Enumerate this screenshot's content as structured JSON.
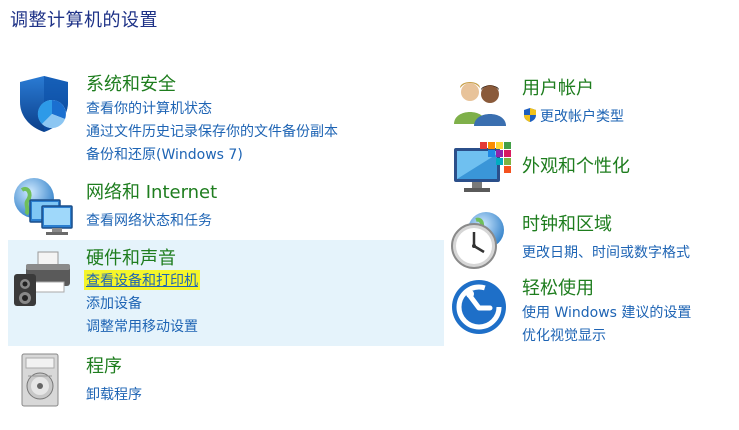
{
  "page": {
    "title": "调整计算机的设置"
  },
  "categories": {
    "system_security": {
      "title": "系统和安全",
      "icon": "security-shield-icon",
      "links": [
        "查看你的计算机状态",
        "通过文件历史记录保存你的文件备份副本",
        "备份和还原(Windows 7)"
      ]
    },
    "network": {
      "title": "网络和 Internet",
      "icon": "network-computers-icon",
      "links": [
        "查看网络状态和任务"
      ]
    },
    "hardware_sound": {
      "title": "硬件和声音",
      "icon": "printer-speaker-icon",
      "links": [
        "查看设备和打印机",
        "添加设备",
        "调整常用移动设置"
      ]
    },
    "programs": {
      "title": "程序",
      "icon": "programs-disc-icon",
      "links": [
        "卸载程序"
      ]
    },
    "user_accounts": {
      "title": "用户帐户",
      "icon": "users-icon",
      "links": [
        "更改帐户类型"
      ]
    },
    "appearance": {
      "title": "外观和个性化",
      "icon": "monitor-palette-icon",
      "links": []
    },
    "clock_region": {
      "title": "时钟和区域",
      "icon": "clock-globe-icon",
      "links": [
        "更改日期、时间或数字格式"
      ]
    },
    "ease_of_access": {
      "title": "轻松使用",
      "icon": "ease-of-access-icon",
      "links": [
        "使用 Windows 建议的设置",
        "优化视觉显示"
      ]
    }
  },
  "colors": {
    "title_blue": "#1e3287",
    "category_green": "#1e7d1e",
    "link_blue": "#1e64b4",
    "hover_background": "#e5f3fb",
    "highlight_yellow": "#f5f52a"
  }
}
